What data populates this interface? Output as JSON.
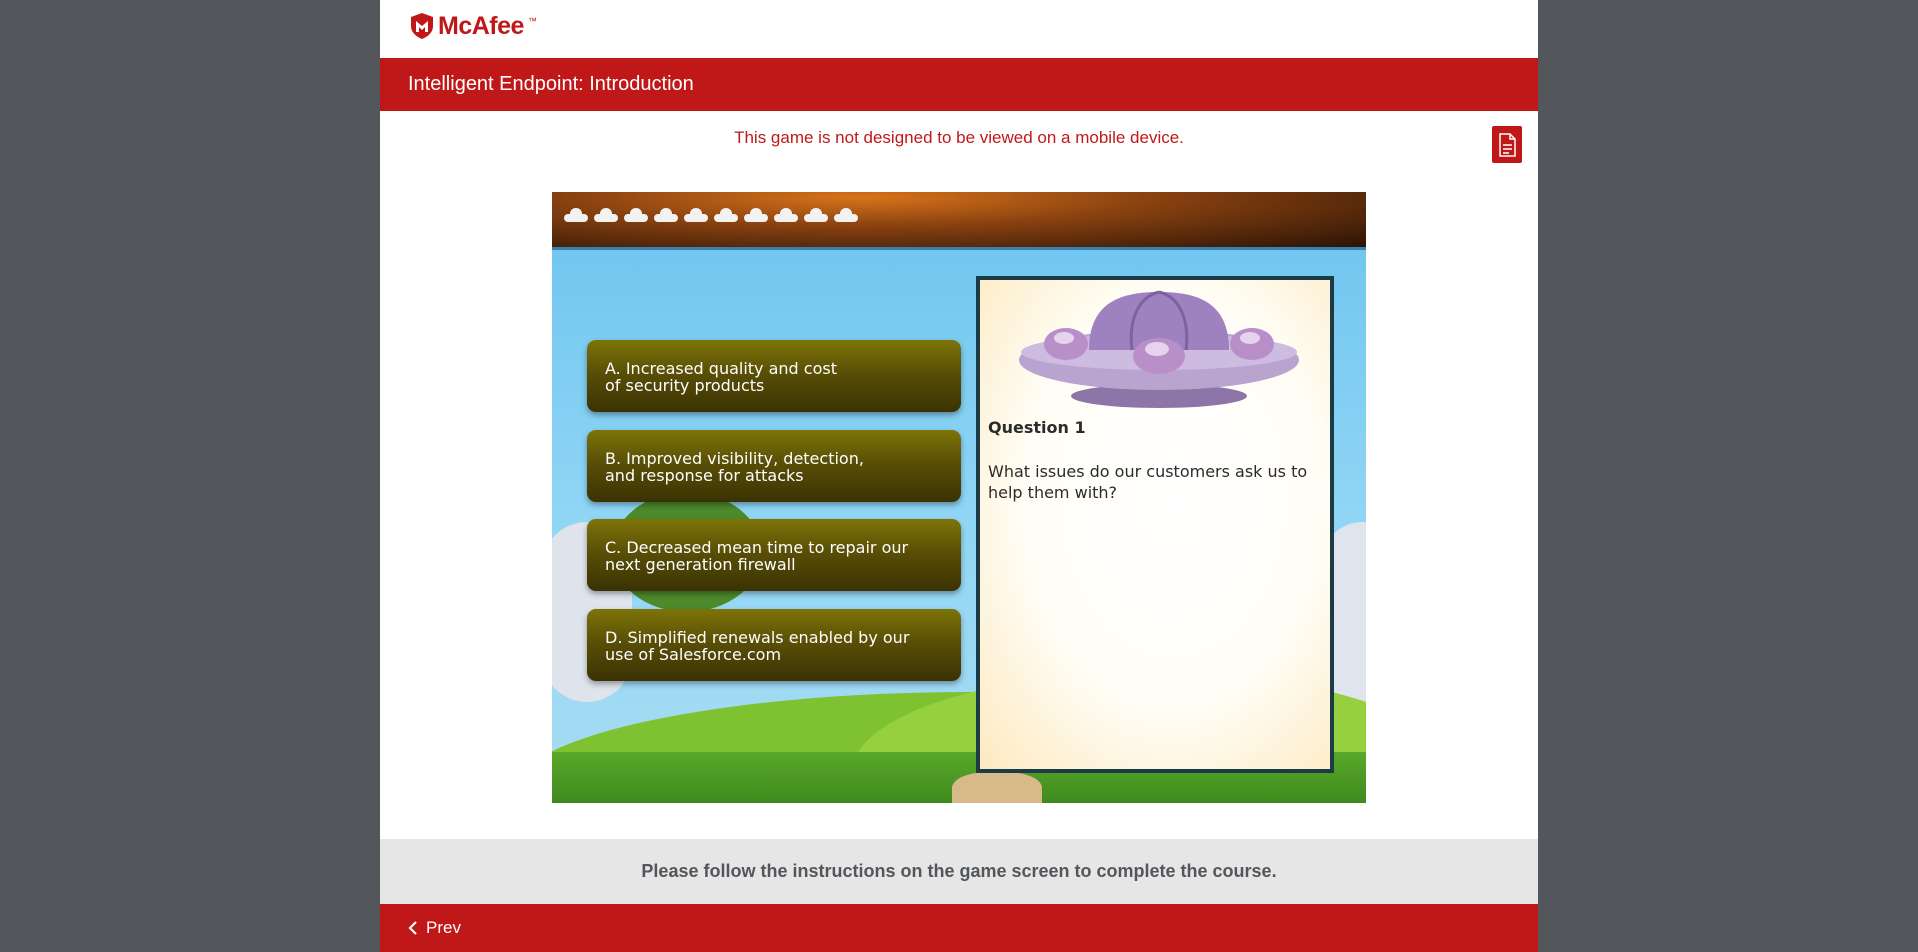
{
  "header": {
    "logo_text": "McAfee",
    "logo_tm": "™"
  },
  "title_bar": {
    "title": "Intelligent Endpoint:  Introduction"
  },
  "notice": {
    "mobile_warning": "This game is not designed to be viewed on a mobile device."
  },
  "toolbar": {
    "document_icon": "document-icon"
  },
  "game": {
    "answers": [
      {
        "label": "A. Increased quality and cost\nof security products"
      },
      {
        "label": "B. Improved visibility, detection,\nand response for attacks"
      },
      {
        "label": "C. Decreased mean time to repair our\nnext generation firewall"
      },
      {
        "label": "D. Simplified renewals enabled by our\nuse of Salesforce.com"
      }
    ],
    "question": {
      "title": "Question 1",
      "text": "What issues do our customers ask us to help them with?"
    }
  },
  "instructions": {
    "text": "Please follow the instructions on the game screen to complete the course."
  },
  "footer": {
    "prev_label": "Prev",
    "prev_icon": "chevron-left-icon"
  },
  "colors": {
    "brand_red": "#c01818",
    "page_background": "#53565a",
    "answer_olive": "#5a4f06"
  }
}
